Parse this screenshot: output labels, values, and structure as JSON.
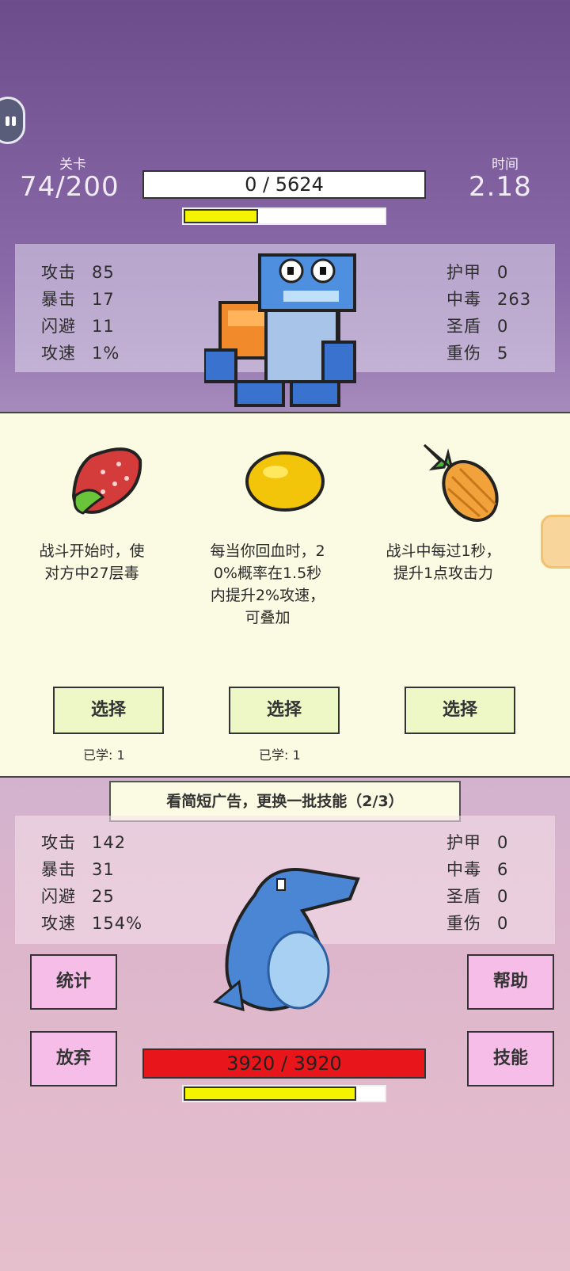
{
  "header": {
    "level_label": "关卡",
    "level_value": "74/200",
    "time_label": "时间",
    "time_value": "2.18",
    "enemy_hp_text": "0 / 5624",
    "enemy_bar_fill_percent": 37
  },
  "enemy_stats": {
    "left": [
      {
        "k": "攻击",
        "v": "85"
      },
      {
        "k": "暴击",
        "v": "17"
      },
      {
        "k": "闪避",
        "v": "11"
      },
      {
        "k": "攻速",
        "v": "1%"
      }
    ],
    "right": [
      {
        "k": "护甲",
        "v": "0"
      },
      {
        "k": "中毒",
        "v": "263"
      },
      {
        "k": "圣盾",
        "v": "0"
      },
      {
        "k": "重伤",
        "v": "5"
      }
    ]
  },
  "cards": [
    {
      "icon": "strawberry-icon",
      "desc": "战斗开始时，使\n对方中27层毒",
      "select": "选择",
      "learned": "已学: 1"
    },
    {
      "icon": "lemon-icon",
      "desc": "每当你回血时，2\n0%概率在1.5秒\n内提升2%攻速，\n可叠加",
      "select": "选择",
      "learned": "已学: 1"
    },
    {
      "icon": "pineapple-icon",
      "desc": "战斗中每过1秒，\n提升1点攻击力",
      "select": "选择",
      "learned": ""
    }
  ],
  "ad_button": "看简短广告，更换一批技能（2/3）",
  "player_stats": {
    "left": [
      {
        "k": "攻击",
        "v": "142"
      },
      {
        "k": "暴击",
        "v": "31"
      },
      {
        "k": "闪避",
        "v": "25"
      },
      {
        "k": "攻速",
        "v": "154%"
      }
    ],
    "right": [
      {
        "k": "护甲",
        "v": "0"
      },
      {
        "k": "中毒",
        "v": "6"
      },
      {
        "k": "圣盾",
        "v": "0"
      },
      {
        "k": "重伤",
        "v": "0"
      }
    ]
  },
  "buttons": {
    "stats": "统计",
    "help": "帮助",
    "quit": "放弃",
    "skills": "技能"
  },
  "player": {
    "hp_text": "3920 / 3920",
    "bar_fill_percent": 86
  },
  "colors": {
    "hp_red": "#e8161a",
    "bar_yellow": "#f4f400",
    "card_bg": "#fbfbe3",
    "pink_button": "#f6bde8"
  }
}
